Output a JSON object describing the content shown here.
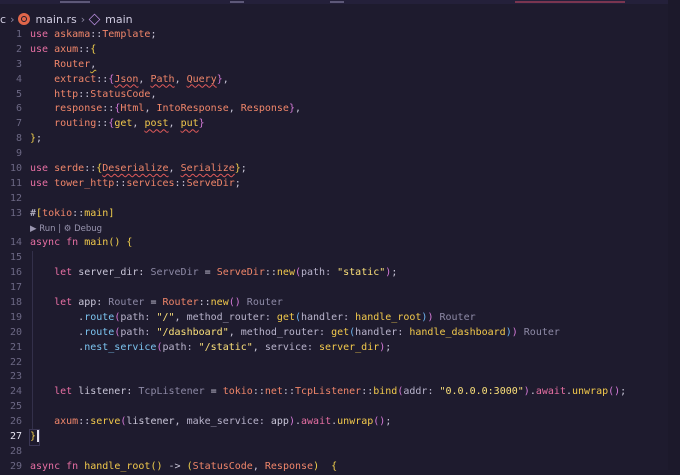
{
  "breadcrumb": {
    "folder_fragment": "c",
    "file": "main.rs",
    "symbol": "main"
  },
  "colors": {
    "keyword": "#e76fa3",
    "module": "#f0866a",
    "type": "#f0866a",
    "ident": "#c9c6d8",
    "func": "#f2c94c",
    "method": "#7cc4f0",
    "string": "#fbe07a",
    "param": "#b9b4cc",
    "hint": "#8e8aa6",
    "bracket1": "#f2d04c",
    "bracket2": "#d57ad8",
    "bracket3": "#6fb5f0",
    "punct": "#c9c6d8",
    "macro": "#e76fa3"
  },
  "code_lens": "▶ Run | ⚙ Debug",
  "lines": [
    {
      "n": "1",
      "tokens": [
        [
          "use",
          "keyword"
        ],
        [
          " ",
          "ident"
        ],
        [
          "askama",
          "module"
        ],
        [
          "::",
          "punct"
        ],
        [
          "Template",
          "type"
        ],
        [
          ";",
          "punct"
        ]
      ]
    },
    {
      "n": "2",
      "tokens": [
        [
          "use",
          "keyword"
        ],
        [
          " ",
          "ident"
        ],
        [
          "axum",
          "module"
        ],
        [
          "::",
          "punct"
        ],
        [
          "{",
          "bracket1"
        ]
      ]
    },
    {
      "n": "3",
      "tokens": [
        [
          "    ",
          "ident"
        ],
        [
          "Router",
          "type"
        ],
        [
          ",",
          "punct"
        ]
      ],
      "squiggle_last": true
    },
    {
      "n": "4",
      "tokens": [
        [
          "    ",
          "ident"
        ],
        [
          "extract",
          "module"
        ],
        [
          "::",
          "punct"
        ],
        [
          "{",
          "bracket2"
        ],
        [
          "Json",
          "type",
          "sq"
        ],
        [
          ", ",
          "punct"
        ],
        [
          "Path",
          "type",
          "sq"
        ],
        [
          ", ",
          "punct"
        ],
        [
          "Query",
          "type",
          "sq"
        ],
        [
          "}",
          "bracket2"
        ],
        [
          ",",
          "punct"
        ]
      ]
    },
    {
      "n": "5",
      "tokens": [
        [
          "    ",
          "ident"
        ],
        [
          "http",
          "module"
        ],
        [
          "::",
          "punct"
        ],
        [
          "StatusCode",
          "type"
        ],
        [
          ",",
          "punct"
        ]
      ]
    },
    {
      "n": "6",
      "tokens": [
        [
          "    ",
          "ident"
        ],
        [
          "response",
          "module"
        ],
        [
          "::",
          "punct"
        ],
        [
          "{",
          "bracket2"
        ],
        [
          "Html",
          "type"
        ],
        [
          ", ",
          "punct"
        ],
        [
          "IntoResponse",
          "type"
        ],
        [
          ", ",
          "punct"
        ],
        [
          "Response",
          "type"
        ],
        [
          "}",
          "bracket2"
        ],
        [
          ",",
          "punct"
        ]
      ]
    },
    {
      "n": "7",
      "tokens": [
        [
          "    ",
          "ident"
        ],
        [
          "routing",
          "module"
        ],
        [
          "::",
          "punct"
        ],
        [
          "{",
          "bracket2"
        ],
        [
          "get",
          "func"
        ],
        [
          ", ",
          "punct"
        ],
        [
          "post",
          "func",
          "sq"
        ],
        [
          ", ",
          "punct"
        ],
        [
          "put",
          "func",
          "sq"
        ],
        [
          "}",
          "bracket2"
        ]
      ]
    },
    {
      "n": "8",
      "tokens": [
        [
          "}",
          "bracket1"
        ],
        [
          ";",
          "punct"
        ]
      ]
    },
    {
      "n": "9",
      "tokens": []
    },
    {
      "n": "10",
      "tokens": [
        [
          "use",
          "keyword"
        ],
        [
          " ",
          "ident"
        ],
        [
          "serde",
          "module"
        ],
        [
          "::",
          "punct"
        ],
        [
          "{",
          "bracket1"
        ],
        [
          "Deserialize",
          "type",
          "sq"
        ],
        [
          ", ",
          "punct"
        ],
        [
          "Serialize",
          "type",
          "sq"
        ],
        [
          "}",
          "bracket1"
        ],
        [
          ";",
          "punct"
        ]
      ]
    },
    {
      "n": "11",
      "tokens": [
        [
          "use",
          "keyword"
        ],
        [
          " ",
          "ident"
        ],
        [
          "tower_http",
          "module"
        ],
        [
          "::",
          "punct"
        ],
        [
          "services",
          "module"
        ],
        [
          "::",
          "punct"
        ],
        [
          "ServeDir",
          "type"
        ],
        [
          ";",
          "punct"
        ]
      ]
    },
    {
      "n": "12",
      "tokens": []
    },
    {
      "n": "13",
      "tokens": [
        [
          "#",
          "punct"
        ],
        [
          "[",
          "bracket1"
        ],
        [
          "tokio",
          "module"
        ],
        [
          "::",
          "punct"
        ],
        [
          "main",
          "func"
        ],
        [
          "]",
          "bracket1"
        ]
      ]
    },
    {
      "n": "",
      "lens": true
    },
    {
      "n": "14",
      "tokens": [
        [
          "async",
          "keyword"
        ],
        [
          " ",
          "ident"
        ],
        [
          "fn",
          "keyword"
        ],
        [
          " ",
          "ident"
        ],
        [
          "main",
          "func"
        ],
        [
          "()",
          "bracket1"
        ],
        [
          " ",
          "ident"
        ],
        [
          "{",
          "bracket1"
        ]
      ]
    },
    {
      "n": "15",
      "tokens": []
    },
    {
      "n": "16",
      "tokens": [
        [
          "    ",
          "ident"
        ],
        [
          "let",
          "keyword"
        ],
        [
          " ",
          "ident"
        ],
        [
          "server_dir",
          "ident"
        ],
        [
          ": ",
          "punct"
        ],
        [
          "ServeDir",
          "hint"
        ],
        [
          " = ",
          "punct"
        ],
        [
          "ServeDir",
          "type"
        ],
        [
          "::",
          "punct"
        ],
        [
          "new",
          "func"
        ],
        [
          "(",
          "bracket2"
        ],
        [
          "path: ",
          "param"
        ],
        [
          "\"static\"",
          "string"
        ],
        [
          ")",
          "bracket2"
        ],
        [
          ";",
          "punct"
        ]
      ]
    },
    {
      "n": "17",
      "tokens": []
    },
    {
      "n": "18",
      "tokens": [
        [
          "    ",
          "ident"
        ],
        [
          "let",
          "keyword"
        ],
        [
          " ",
          "ident"
        ],
        [
          "app",
          "ident"
        ],
        [
          ": ",
          "punct"
        ],
        [
          "Router",
          "hint"
        ],
        [
          " = ",
          "punct"
        ],
        [
          "Router",
          "type"
        ],
        [
          "::",
          "punct"
        ],
        [
          "new",
          "func"
        ],
        [
          "()",
          "bracket2"
        ],
        [
          " ",
          "ident"
        ],
        [
          "Router",
          "hint"
        ]
      ]
    },
    {
      "n": "19",
      "tokens": [
        [
          "        ",
          "ident"
        ],
        [
          ".",
          "punct"
        ],
        [
          "route",
          "method"
        ],
        [
          "(",
          "bracket2"
        ],
        [
          "path: ",
          "param"
        ],
        [
          "\"/\"",
          "string"
        ],
        [
          ", ",
          "punct"
        ],
        [
          "method_router: ",
          "param"
        ],
        [
          "get",
          "func"
        ],
        [
          "(",
          "bracket3"
        ],
        [
          "handler: ",
          "param"
        ],
        [
          "handle_root",
          "func"
        ],
        [
          ")",
          "bracket3"
        ],
        [
          ")",
          "bracket2"
        ],
        [
          " ",
          "ident"
        ],
        [
          "Router",
          "hint"
        ]
      ]
    },
    {
      "n": "20",
      "tokens": [
        [
          "        ",
          "ident"
        ],
        [
          ".",
          "punct"
        ],
        [
          "route",
          "method"
        ],
        [
          "(",
          "bracket2"
        ],
        [
          "path: ",
          "param"
        ],
        [
          "\"/dashboard\"",
          "string"
        ],
        [
          ", ",
          "punct"
        ],
        [
          "method_router: ",
          "param"
        ],
        [
          "get",
          "func"
        ],
        [
          "(",
          "bracket3"
        ],
        [
          "handler: ",
          "param"
        ],
        [
          "handle_dashboard",
          "func"
        ],
        [
          ")",
          "bracket3"
        ],
        [
          ")",
          "bracket2"
        ],
        [
          " ",
          "ident"
        ],
        [
          "Router",
          "hint"
        ]
      ]
    },
    {
      "n": "21",
      "tokens": [
        [
          "        ",
          "ident"
        ],
        [
          ".",
          "punct"
        ],
        [
          "nest_service",
          "method"
        ],
        [
          "(",
          "bracket2"
        ],
        [
          "path: ",
          "param"
        ],
        [
          "\"/static\"",
          "string"
        ],
        [
          ", ",
          "punct"
        ],
        [
          "service: ",
          "param"
        ],
        [
          "server_dir",
          "func"
        ],
        [
          ")",
          "bracket2"
        ],
        [
          ";",
          "punct"
        ]
      ]
    },
    {
      "n": "22",
      "tokens": []
    },
    {
      "n": "23",
      "tokens": []
    },
    {
      "n": "24",
      "tokens": [
        [
          "    ",
          "ident"
        ],
        [
          "let",
          "keyword"
        ],
        [
          " ",
          "ident"
        ],
        [
          "listener",
          "ident"
        ],
        [
          ": ",
          "punct"
        ],
        [
          "TcpListener",
          "hint"
        ],
        [
          " = ",
          "punct"
        ],
        [
          "tokio",
          "module"
        ],
        [
          "::",
          "punct"
        ],
        [
          "net",
          "module"
        ],
        [
          "::",
          "punct"
        ],
        [
          "TcpListener",
          "type"
        ],
        [
          "::",
          "punct"
        ],
        [
          "bind",
          "func"
        ],
        [
          "(",
          "bracket2"
        ],
        [
          "addr: ",
          "param"
        ],
        [
          "\"0.0.0.0:3000\"",
          "string"
        ],
        [
          ")",
          "bracket2"
        ],
        [
          ".",
          "punct"
        ],
        [
          "await",
          "keyword"
        ],
        [
          ".",
          "punct"
        ],
        [
          "unwrap",
          "func"
        ],
        [
          "()",
          "bracket2"
        ],
        [
          ";",
          "punct"
        ]
      ]
    },
    {
      "n": "25",
      "tokens": []
    },
    {
      "n": "26",
      "tokens": [
        [
          "    ",
          "ident"
        ],
        [
          "axum",
          "module"
        ],
        [
          "::",
          "punct"
        ],
        [
          "serve",
          "func"
        ],
        [
          "(",
          "bracket2"
        ],
        [
          "listener",
          "ident"
        ],
        [
          ", ",
          "punct"
        ],
        [
          "make_service: ",
          "param"
        ],
        [
          "app",
          "ident"
        ],
        [
          ")",
          "bracket2"
        ],
        [
          ".",
          "punct"
        ],
        [
          "await",
          "keyword"
        ],
        [
          ".",
          "punct"
        ],
        [
          "unwrap",
          "func"
        ],
        [
          "()",
          "bracket2"
        ],
        [
          ";",
          "punct"
        ]
      ]
    },
    {
      "n": "27",
      "tokens": [
        [
          "}",
          "bracket1"
        ]
      ],
      "active": true
    },
    {
      "n": "28",
      "tokens": []
    },
    {
      "n": "29",
      "tokens": [
        [
          "async",
          "keyword"
        ],
        [
          " ",
          "ident"
        ],
        [
          "fn",
          "keyword"
        ],
        [
          " ",
          "ident"
        ],
        [
          "handle_root",
          "func"
        ],
        [
          "()",
          "bracket1"
        ],
        [
          " -> ",
          "punct"
        ],
        [
          "(",
          "bracket1"
        ],
        [
          "StatusCode",
          "type"
        ],
        [
          ", ",
          "punct"
        ],
        [
          "Response",
          "type"
        ],
        [
          ")",
          "bracket1"
        ],
        [
          "  ",
          "ident"
        ],
        [
          "{",
          "bracket1"
        ]
      ]
    }
  ]
}
